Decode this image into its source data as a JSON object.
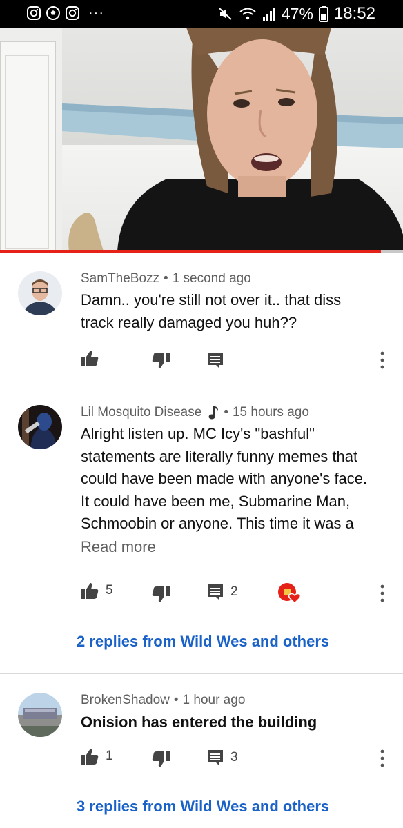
{
  "status_bar": {
    "left_icons": [
      "instagram-icon",
      "soccer-ball-icon",
      "instagram-icon"
    ],
    "more": "···",
    "battery": "47%",
    "time": "18:52"
  },
  "video": {
    "progress": 0.945
  },
  "comments": [
    {
      "author": "SamTheBozz",
      "time": "1 second ago",
      "lines": [
        "Damn.. you're still not over it.. that diss",
        "track really damaged you huh??"
      ],
      "likes": "",
      "replies_count": ""
    },
    {
      "author": "Lil Mosquito Disease",
      "author_badge": "music-note-icon",
      "time": "15 hours ago",
      "lines": [
        "Alright listen up. MC Icy's \"bashful\"",
        "statements are literally funny memes that",
        "could have been made with anyone's face.",
        "It could have been me, Submarine Man,",
        "Schmoobin or anyone. This time it was a"
      ],
      "read_more": "Read more",
      "likes": "5",
      "replies_count": "2",
      "replies_link": "2 replies from Wild Wes and others"
    },
    {
      "author": "BrokenShadow",
      "time": "1 hour ago",
      "lines": [
        "Onision has entered the building"
      ],
      "likes": "1",
      "replies_count": "3",
      "replies_link": "3 replies from Wild Wes and others"
    }
  ],
  "colors": {
    "link": "#1a62c7",
    "progress": "#e62117",
    "heart": "#e62117"
  }
}
